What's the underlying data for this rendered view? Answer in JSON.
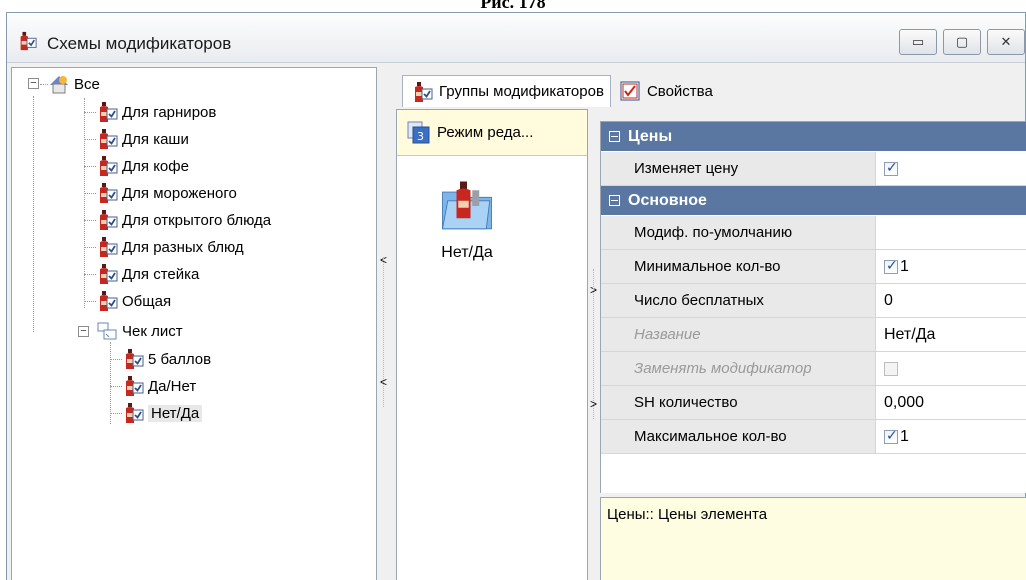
{
  "caption": "Рис. 178",
  "window": {
    "title": "Схемы модификаторов",
    "buttons": {
      "minimize": "▭",
      "maximize": "▢",
      "close": "✕"
    }
  },
  "tree": {
    "root": "Все",
    "items": [
      "Для гарниров",
      "Для каши",
      "Для кофе",
      "Для мороженого",
      "Для открытого блюда",
      "Для разных блюд",
      "Для стейка",
      "Общая"
    ],
    "checklist": {
      "label": "Чек лист",
      "children": [
        "5 баллов",
        "Да/Нет",
        "Нет/Да"
      ],
      "selected": "Нет/Да"
    }
  },
  "tabs": [
    {
      "label": "Группы модификаторов",
      "active": true
    },
    {
      "label": "Свойства",
      "active": false
    }
  ],
  "mid": {
    "mode_button": "Режим реда...",
    "group_item": "Нет/Да"
  },
  "properties": {
    "categories": [
      {
        "title": "Цены",
        "rows": [
          {
            "name": "Изменяет цену",
            "checkbox": true,
            "checked": true,
            "value": ""
          }
        ]
      },
      {
        "title": "Основное",
        "rows": [
          {
            "name": "Модиф. по-умолчанию",
            "checkbox": false,
            "value": ""
          },
          {
            "name": "Минимальное кол-во",
            "checkbox": true,
            "checked": true,
            "value": "1"
          },
          {
            "name": "Число бесплатных",
            "checkbox": false,
            "value": "0"
          },
          {
            "name": "Название",
            "checkbox": false,
            "value": "Нет/Да",
            "disabled": true
          },
          {
            "name": "Заменять модификатор",
            "checkbox": true,
            "checked": false,
            "value": "",
            "disabled": true
          },
          {
            "name": "SH количество",
            "checkbox": false,
            "value": "0,000"
          },
          {
            "name": "Максимальное кол-во",
            "checkbox": true,
            "checked": true,
            "value": "1"
          }
        ]
      }
    ],
    "description": "Цены:: Цены элемента"
  },
  "colors": {
    "category_header": "#5a77a2",
    "selection_bg": "#fffbdc",
    "description_bg": "#fffde1"
  }
}
